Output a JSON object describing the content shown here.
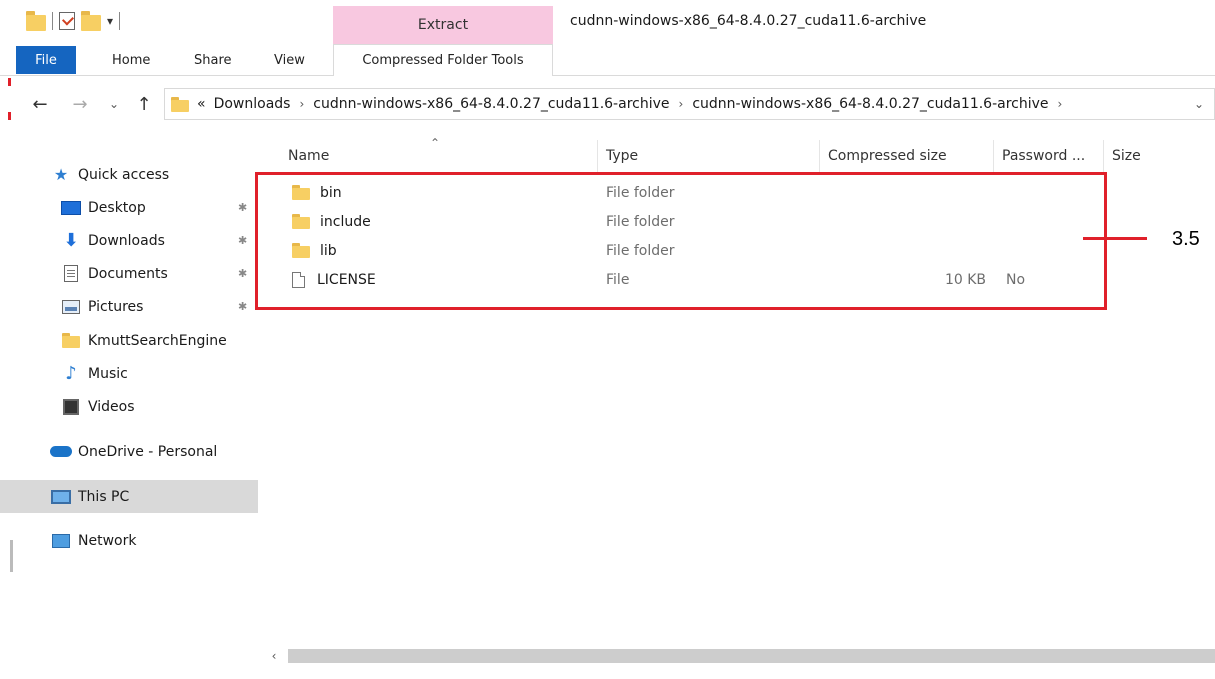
{
  "window": {
    "title": "cudnn-windows-x86_64-8.4.0.27_cuda11.6-archive",
    "contextual_tab": "Extract"
  },
  "ribbon": {
    "tabs": [
      "File",
      "Home",
      "Share",
      "View",
      "Compressed Folder Tools"
    ]
  },
  "address": {
    "overflow": "«",
    "crumbs": [
      "Downloads",
      "cudnn-windows-x86_64-8.4.0.27_cuda11.6-archive",
      "cudnn-windows-x86_64-8.4.0.27_cuda11.6-archive"
    ]
  },
  "nav": {
    "items": [
      {
        "label": "Quick access",
        "icon": "star-icon"
      },
      {
        "label": "Desktop",
        "icon": "desktop-icon",
        "pinned": true
      },
      {
        "label": "Downloads",
        "icon": "download-arrow-icon",
        "pinned": true
      },
      {
        "label": "Documents",
        "icon": "document-icon",
        "pinned": true
      },
      {
        "label": "Pictures",
        "icon": "pictures-icon",
        "pinned": true
      },
      {
        "label": "KmuttSearchEngine",
        "icon": "folder-icon"
      },
      {
        "label": "Music",
        "icon": "music-note-icon"
      },
      {
        "label": "Videos",
        "icon": "video-icon"
      },
      {
        "label": "OneDrive - Personal",
        "icon": "cloud-icon"
      },
      {
        "label": "This PC",
        "icon": "computer-icon",
        "selected": true
      },
      {
        "label": "Network",
        "icon": "network-icon"
      }
    ]
  },
  "columns": {
    "name": "Name",
    "type": "Type",
    "compressed_size": "Compressed size",
    "password": "Password ...",
    "size": "Size"
  },
  "files": [
    {
      "name": "bin",
      "type": "File folder",
      "compressed_size": "",
      "password": "",
      "kind": "folder"
    },
    {
      "name": "include",
      "type": "File folder",
      "compressed_size": "",
      "password": "",
      "kind": "folder"
    },
    {
      "name": "lib",
      "type": "File folder",
      "compressed_size": "",
      "password": "",
      "kind": "folder"
    },
    {
      "name": "LICENSE",
      "type": "File",
      "compressed_size": "10 KB",
      "password": "No",
      "kind": "file"
    }
  ],
  "annotation": {
    "label": "3.5",
    "color": "#e0202a"
  },
  "colors": {
    "file_tab": "#1565c0",
    "contextual_tab": "#f8c8e0",
    "selected_nav": "#d9d9d9"
  }
}
